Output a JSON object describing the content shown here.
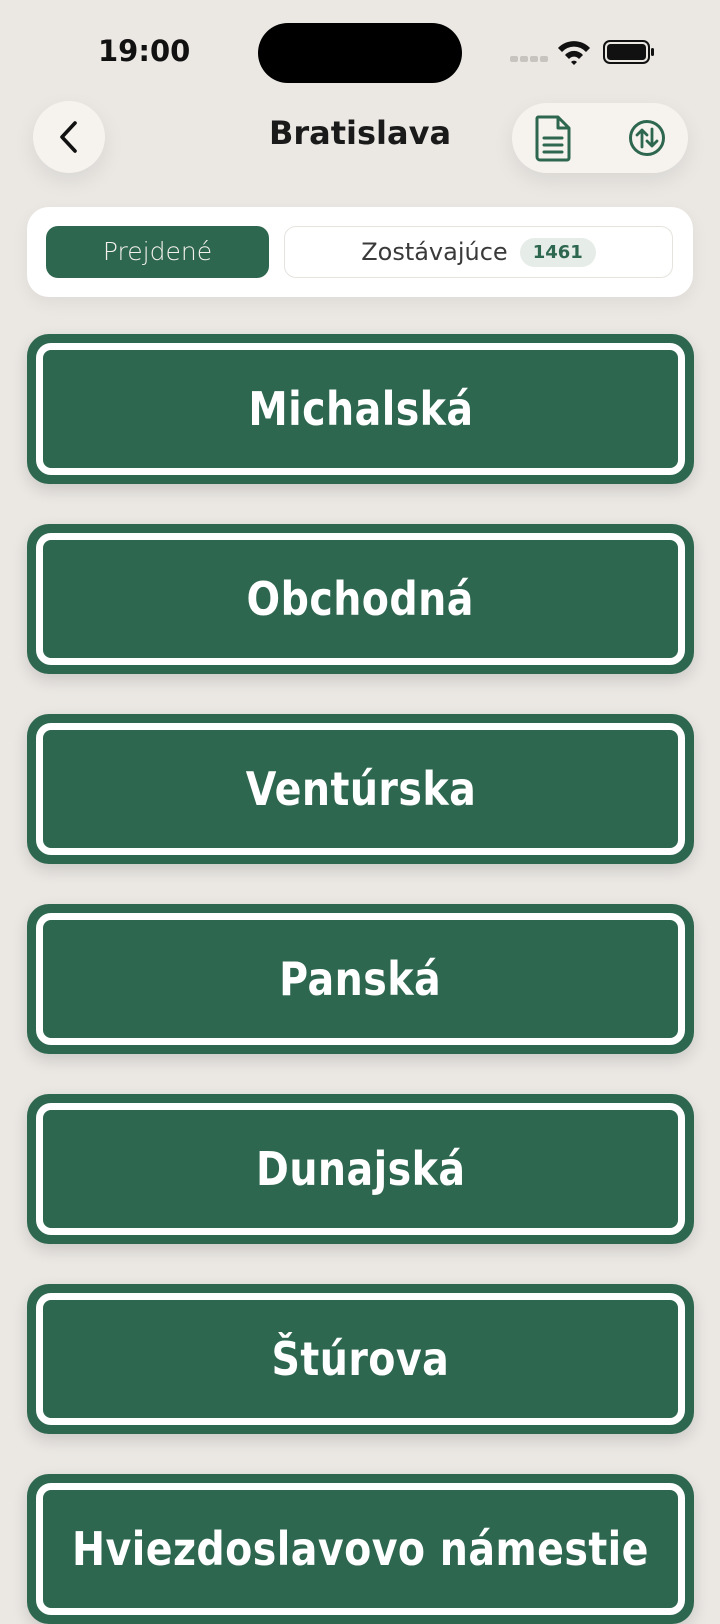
{
  "status_bar": {
    "time": "19:00"
  },
  "header": {
    "title": "Bratislava"
  },
  "tabs": {
    "visited_label": "Prejdené",
    "remaining_label": "Zostávajúce",
    "remaining_count": "1461"
  },
  "streets": [
    {
      "name": "Michalská"
    },
    {
      "name": "Obchodná"
    },
    {
      "name": "Ventúrska"
    },
    {
      "name": "Panská"
    },
    {
      "name": "Dunajská"
    },
    {
      "name": "Štúrova"
    },
    {
      "name": "Hviezdoslavovo námestie"
    }
  ],
  "colors": {
    "sign_green": "#2e6750",
    "background": "#ebe8e4",
    "button_bg": "#f6f3ef"
  },
  "icons": {
    "back": "chevron-left-icon",
    "document": "document-icon",
    "sort": "sort-arrows-icon"
  }
}
